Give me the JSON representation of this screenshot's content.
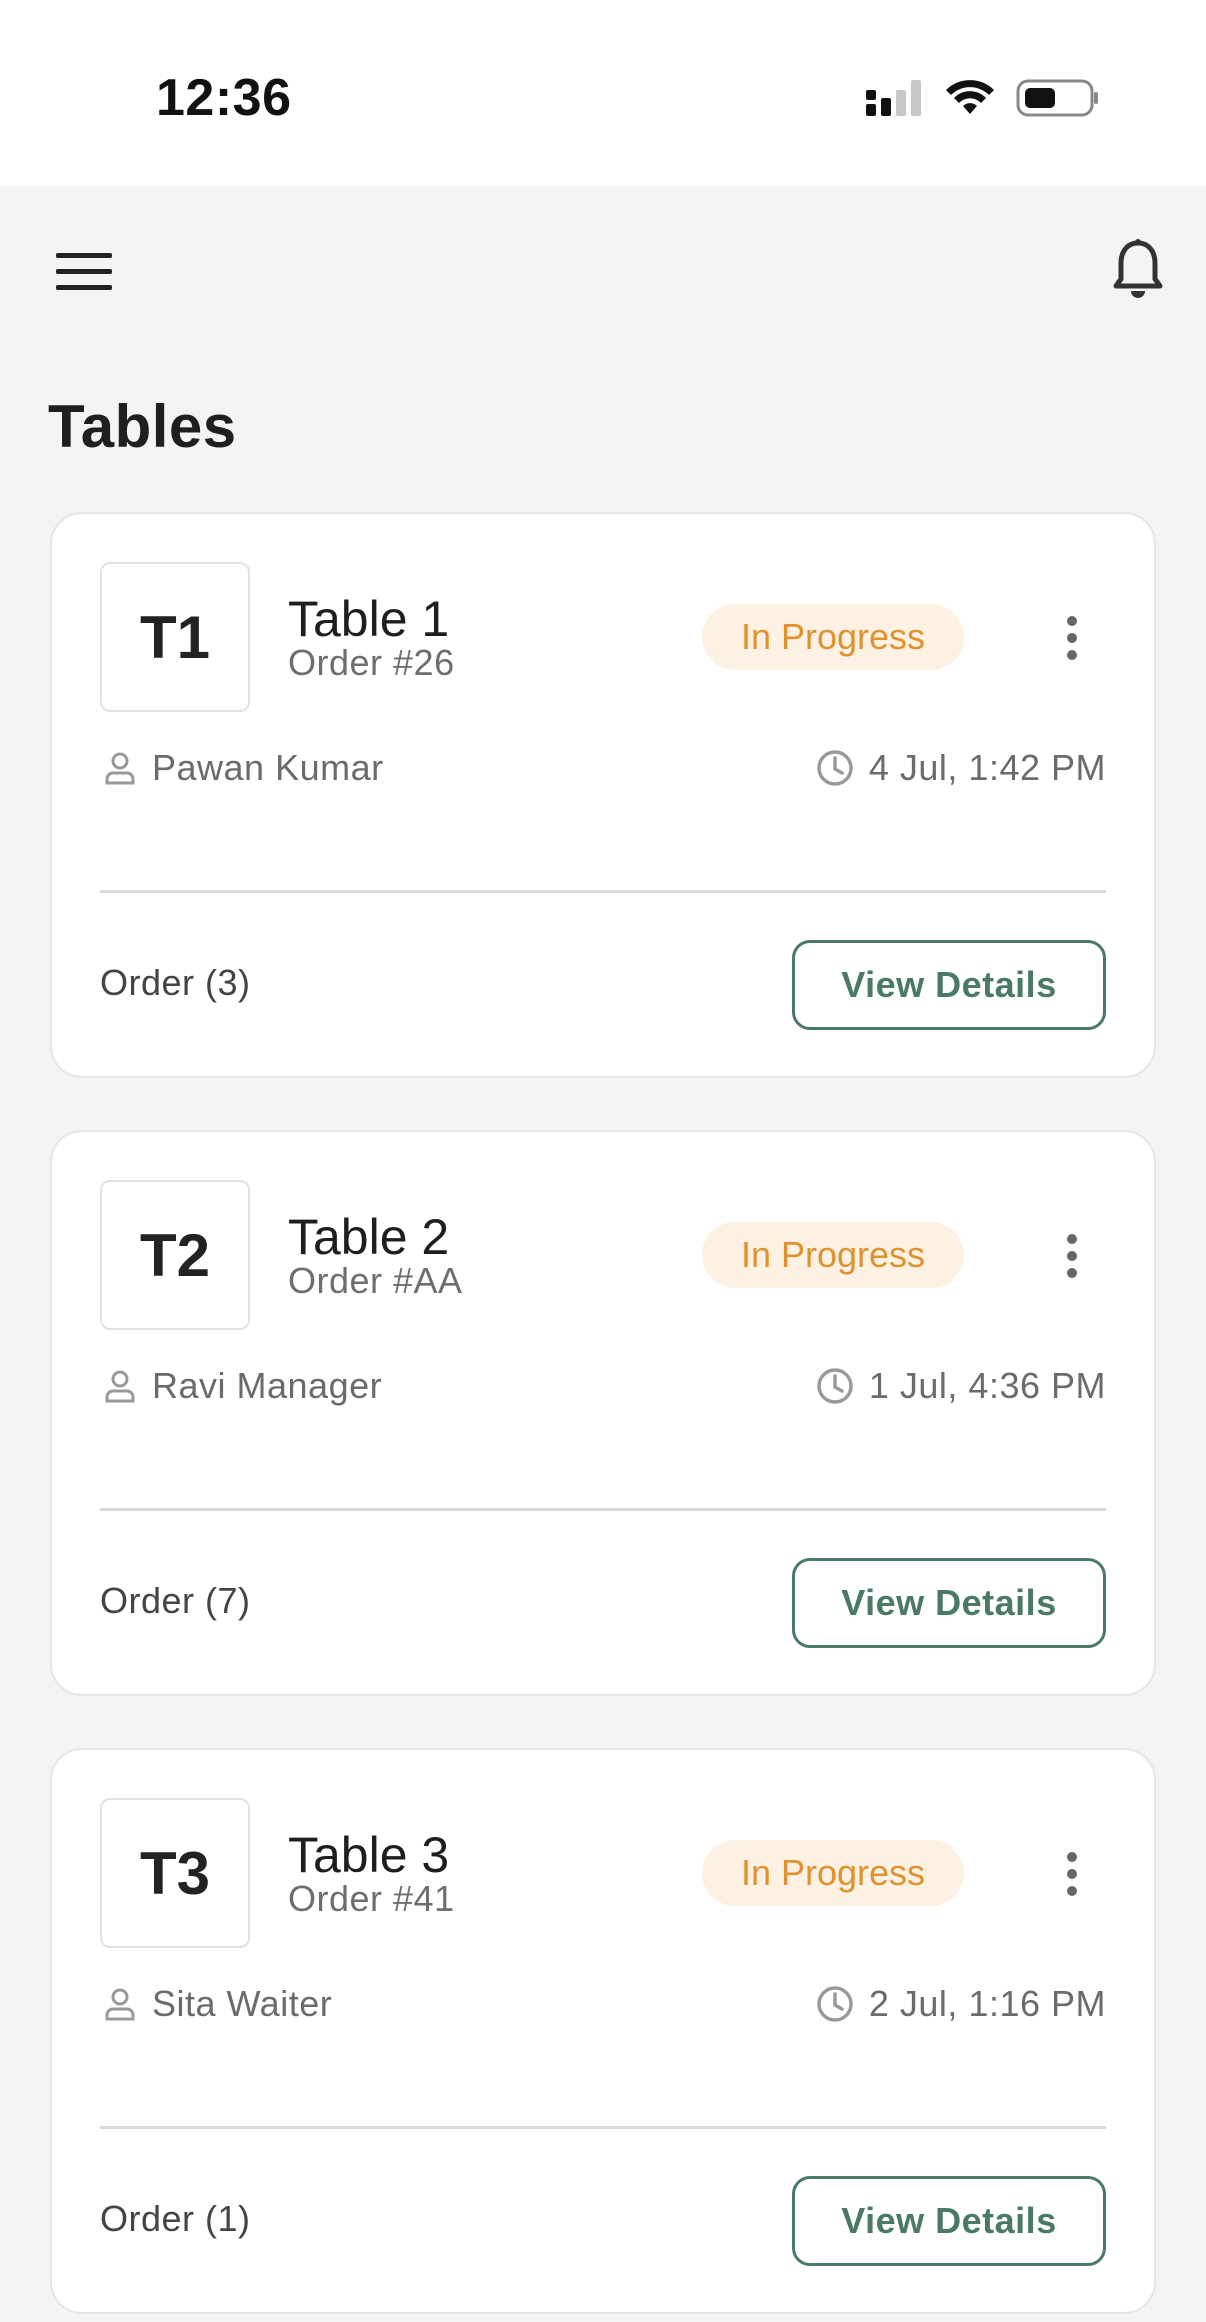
{
  "status_bar": {
    "time": "12:36"
  },
  "header": {
    "menu_icon": "hamburger-menu-icon",
    "bell_icon": "bell-icon"
  },
  "page": {
    "title": "Tables"
  },
  "colors": {
    "accent": "#4a7a64",
    "status_text": "#e0922e",
    "status_bg": "#fcf1e2",
    "background": "#f4f4f4"
  },
  "tables": [
    {
      "badge": "T1",
      "name": "Table 1",
      "order": "Order #26",
      "status": "In Progress",
      "staff": "Pawan Kumar",
      "time": "4 Jul, 1:42 PM",
      "order_count": "Order (3)",
      "action": "View Details"
    },
    {
      "badge": "T2",
      "name": "Table 2",
      "order": "Order #AA",
      "status": "In Progress",
      "staff": "Ravi Manager",
      "time": "1 Jul, 4:36 PM",
      "order_count": "Order (7)",
      "action": "View Details"
    },
    {
      "badge": "T3",
      "name": "Table 3",
      "order": "Order #41",
      "status": "In Progress",
      "staff": "Sita Waiter",
      "time": "2 Jul, 1:16 PM",
      "order_count": "Order (1)",
      "action": "View Details"
    }
  ]
}
